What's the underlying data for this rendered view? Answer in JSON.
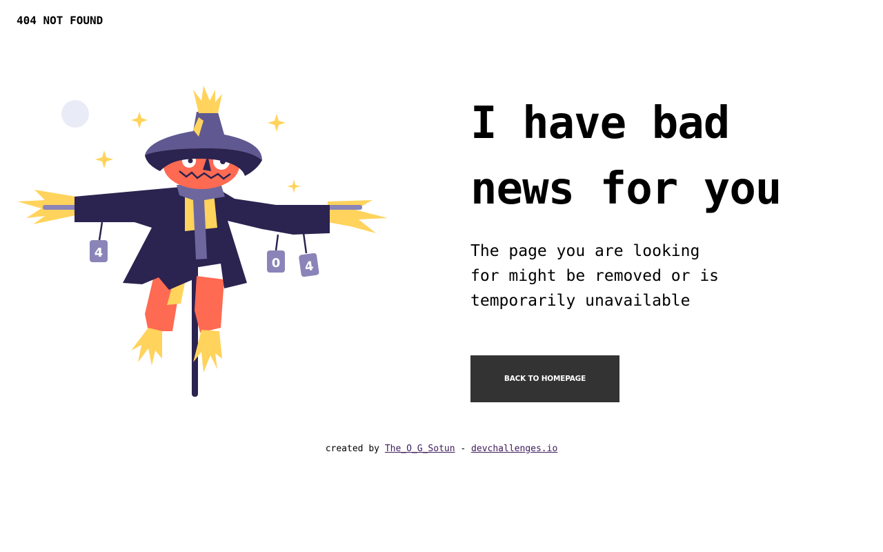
{
  "header": {
    "brand": "404 NOT FOUND"
  },
  "illustration": {
    "name": "scarecrow",
    "can_labels": [
      "4",
      "0",
      "4"
    ]
  },
  "main": {
    "title": "I have bad\nnews for you",
    "message": "The page you are looking for might be removed or is temporarily unavailable",
    "button_label": "BACK TO HOMEPAGE"
  },
  "footer": {
    "prefix": "created by",
    "author": "The_O_G_Sotun",
    "separator": "-",
    "site": "devchallenges.io"
  },
  "colors": {
    "button_bg": "#333333",
    "hat": "#5f5891",
    "coat": "#2b2350",
    "face": "#ff6a52",
    "straw": "#ffd35c",
    "can": "#8a84b8",
    "link": "#3d1a5a"
  }
}
